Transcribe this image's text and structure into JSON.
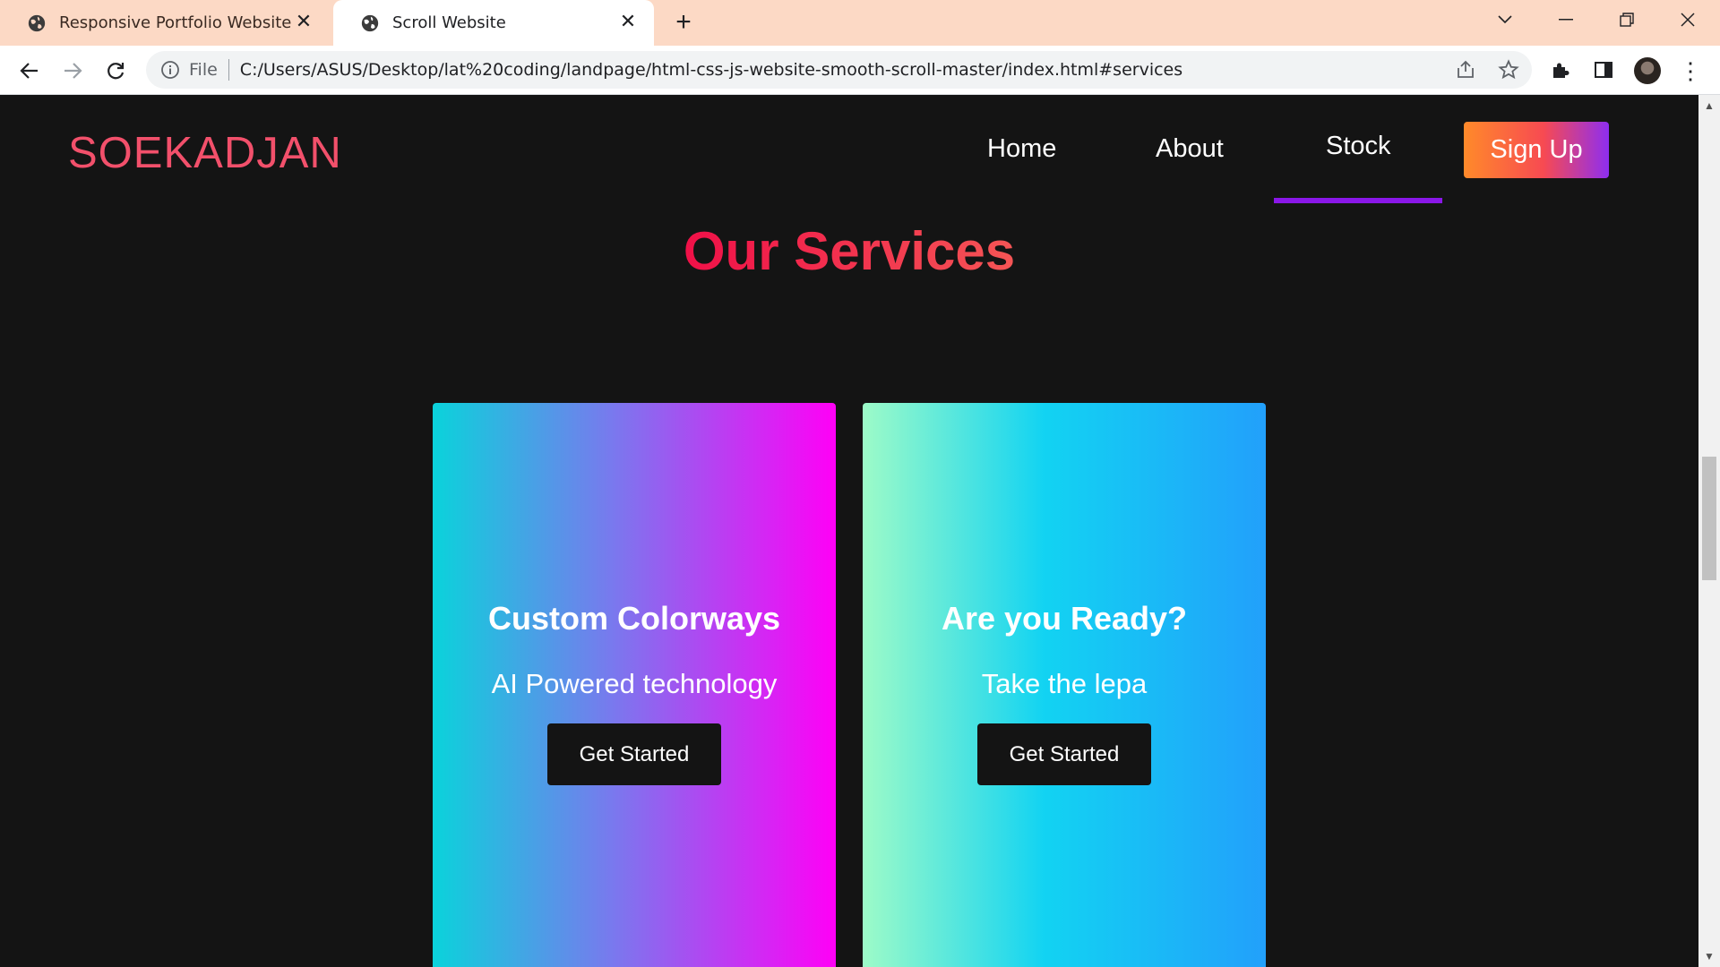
{
  "browser": {
    "tabs": [
      {
        "title": "Responsive Portfolio Website",
        "active": false
      },
      {
        "title": "Scroll Website",
        "active": true
      }
    ],
    "address": {
      "scheme_label": "File",
      "url": "C:/Users/ASUS/Desktop/lat%20coding/landpage/html-css-js-website-smooth-scroll-master/index.html#services"
    },
    "colors": {
      "tabbar": "#fcd9c5",
      "toolbar": "#ffffff"
    }
  },
  "site": {
    "logo": "SOEKADJAN",
    "nav": [
      {
        "label": "Home",
        "active": false
      },
      {
        "label": "About",
        "active": false
      },
      {
        "label": "Stock",
        "active": true
      }
    ],
    "signup_label": "Sign Up",
    "colors": {
      "logo": "#f2506b",
      "active_underline": "#8a17e8",
      "background": "#141414"
    }
  },
  "services": {
    "title": "Our Services",
    "cards": [
      {
        "title": "Custom Colorways",
        "subtitle": "AI Powered technology",
        "button": "Get Started"
      },
      {
        "title": "Are you Ready?",
        "subtitle": "Take the lepa",
        "button": "Get Started"
      }
    ]
  }
}
